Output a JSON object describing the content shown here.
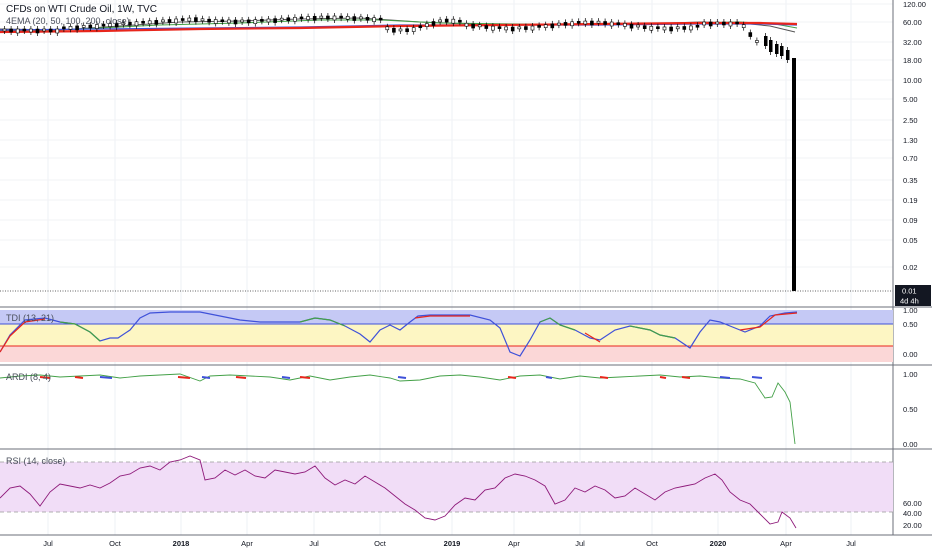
{
  "main": {
    "title": "CFDs on WTI Crude Oil, 1W, TVC",
    "indicator_label": "4EMA (20, 50, 100, 200, close)",
    "price_ticks": [
      "120.00",
      "60.00",
      "32.00",
      "18.00",
      "10.00",
      "5.00",
      "2.50",
      "1.30",
      "0.70",
      "0.35",
      "0.19",
      "0.09",
      "0.05",
      "0.02"
    ],
    "last_price_label": "0.01",
    "countdown_label": "4d 4h"
  },
  "tdi": {
    "label": "TDI (13, 21)",
    "ticks": [
      "1.00",
      "0.50",
      "0.00"
    ]
  },
  "ardi": {
    "label": "ARDI (8, 4)",
    "ticks": [
      "1.00",
      "0.50",
      "0.00"
    ]
  },
  "rsi": {
    "label": "RSI (14, close)",
    "ticks": [
      "60.00",
      "40.00",
      "20.00"
    ]
  },
  "time_axis": {
    "labels": [
      {
        "text": "Jul",
        "bold": false
      },
      {
        "text": "Oct",
        "bold": false
      },
      {
        "text": "2018",
        "bold": true
      },
      {
        "text": "Apr",
        "bold": false
      },
      {
        "text": "Jul",
        "bold": false
      },
      {
        "text": "Oct",
        "bold": false
      },
      {
        "text": "2019",
        "bold": true
      },
      {
        "text": "Apr",
        "bold": false
      },
      {
        "text": "Jul",
        "bold": false
      },
      {
        "text": "Oct",
        "bold": false
      },
      {
        "text": "2020",
        "bold": true
      },
      {
        "text": "Apr",
        "bold": false
      },
      {
        "text": "Jul",
        "bold": false
      }
    ]
  },
  "colors": {
    "ema_red": "#e8261c",
    "ema_blue": "#3f51d9",
    "ema_green": "#43a047",
    "ema_dark": "#555555",
    "tdi_band": "#c5c9f5",
    "tdi_mid": "#fdf6c3",
    "tdi_low": "#fbd7d7",
    "rsi_band": "#f1ddf7",
    "rsi_line": "#8e1a7a"
  }
}
